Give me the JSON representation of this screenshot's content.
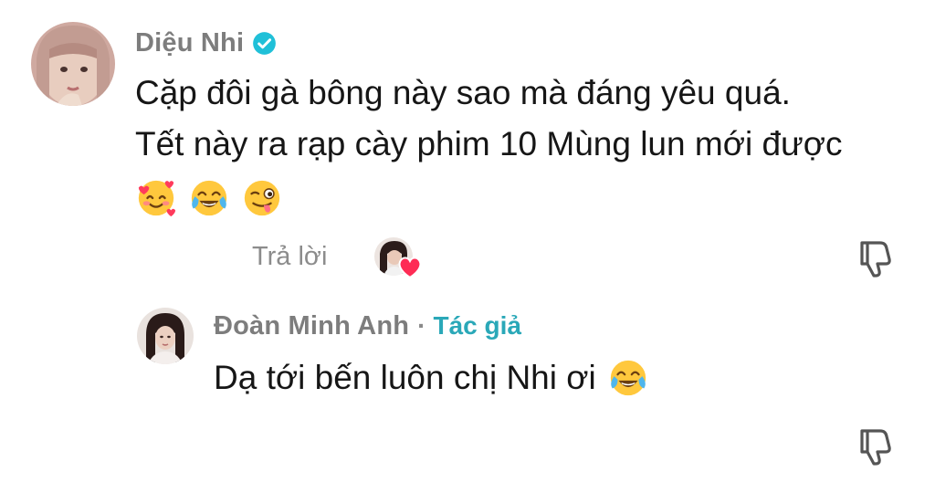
{
  "comment": {
    "author": "Diệu Nhi",
    "verified": true,
    "text_lines": [
      "Cặp đôi gà bông này sao mà đáng yêu quá.",
      "Tết này ra rạp cày phim 10 Mùng lun mới được"
    ],
    "emojis": [
      "smiling-face-with-hearts",
      "face-with-tears-of-joy",
      "winking-face-with-tongue"
    ],
    "reply_label": "Trả lời",
    "liked_by_creator": true
  },
  "reply": {
    "author": "Đoàn Minh Anh",
    "separator": "·",
    "badge": "Tác giả",
    "text": "Dạ tới bến luôn chị Nhi ơi",
    "emojis": [
      "face-with-tears-of-joy"
    ]
  },
  "colors": {
    "name_gray": "#7d7d7d",
    "author_badge": "#2aa8b8",
    "verified_blue": "#20c0d8",
    "heart_red": "#fe2c55",
    "text": "#161616"
  }
}
